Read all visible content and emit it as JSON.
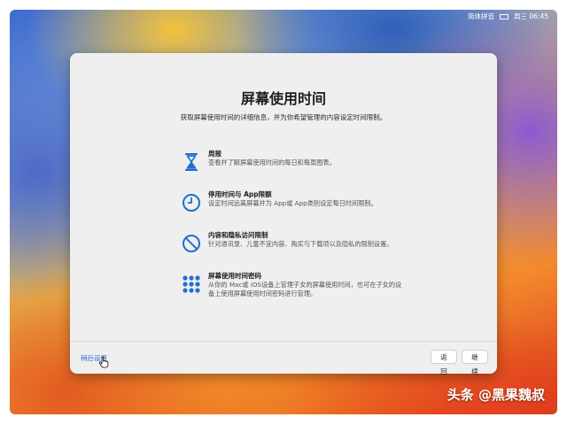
{
  "menubar": {
    "input_method": "简体拼音",
    "datetime": "周三 06:45"
  },
  "dialog": {
    "title": "屏幕使用时间",
    "subtitle": "获取屏幕使用时间的详细信息，并为你希望管理的内容设定时间限制。",
    "features": [
      {
        "icon": "hourglass-icon",
        "title": "周报",
        "description": "查看并了解屏幕使用时间的每日和每周图表。"
      },
      {
        "icon": "clock-icon",
        "title": "停用时间与 App限额",
        "description": "设定时间远离屏幕并为 App或 App类别设定每日时间限制。"
      },
      {
        "icon": "prohibited-icon",
        "title": "内容和隐私访问限制",
        "description": "针对通讯录、儿童不宜内容、购买与下载项以及隐私的限制设置。"
      },
      {
        "icon": "passcode-grid-icon",
        "title": "屏幕使用时间密码",
        "description": "从你的 Mac或 iOS设备上管理子女的屏幕使用时间，也可在子女的设备上使用屏幕使用时间密码进行管理。"
      }
    ],
    "later_link": "稍后设置",
    "back_button": "返回",
    "continue_button": "继续"
  },
  "watermark": "头条 @黑果魏叔",
  "colors": {
    "accent": "#1f6fd1",
    "link": "#2d6fd0"
  }
}
